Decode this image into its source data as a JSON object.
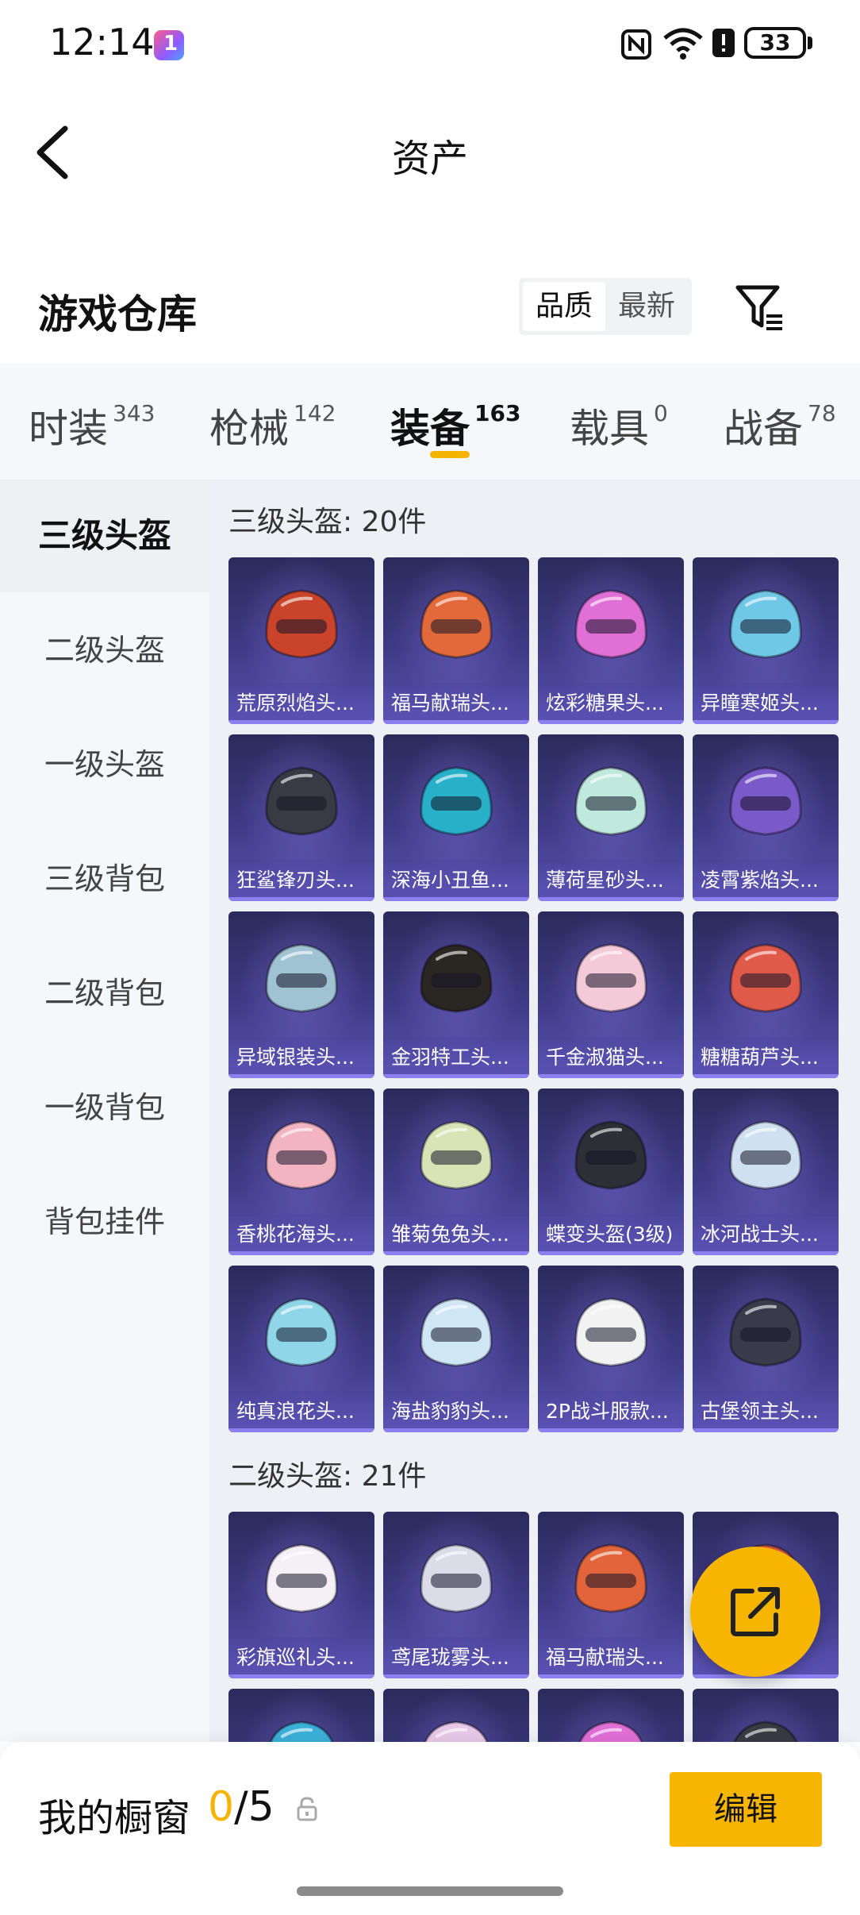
{
  "status_bar": {
    "time": "12:14",
    "battery": "33",
    "icons": [
      "app-badge-icon",
      "nfc-icon",
      "wifi-icon",
      "alert-icon",
      "battery-icon"
    ]
  },
  "header": {
    "title": "资产",
    "back_icon": "chevron-left-icon"
  },
  "warehouse": {
    "title": "游戏仓库",
    "sort_options": [
      "品质",
      "最新"
    ],
    "sort_selected": "品质",
    "filter_icon": "filter-icon"
  },
  "tabs": [
    {
      "label": "时装",
      "count": "343"
    },
    {
      "label": "枪械",
      "count": "142"
    },
    {
      "label": "装备",
      "count": "163",
      "active": true
    },
    {
      "label": "载具",
      "count": "0"
    },
    {
      "label": "战备",
      "count": "78"
    }
  ],
  "sidebar": [
    {
      "label": "三级头盔",
      "active": true
    },
    {
      "label": "二级头盔"
    },
    {
      "label": "一级头盔"
    },
    {
      "label": "三级背包"
    },
    {
      "label": "二级背包"
    },
    {
      "label": "一级背包"
    },
    {
      "label": "背包挂件"
    }
  ],
  "groups": [
    {
      "title": "三级头盔: 20件",
      "items": [
        {
          "name": "荒原烈焰头...",
          "color": "#c9442a"
        },
        {
          "name": "福马献瑞头...",
          "color": "#e26a3a"
        },
        {
          "name": "炫彩糖果头...",
          "color": "#e06fd6"
        },
        {
          "name": "异瞳寒姬头...",
          "color": "#6fc9e6"
        },
        {
          "name": "狂鲨锋刃头...",
          "color": "#3a3a44"
        },
        {
          "name": "深海小丑鱼...",
          "color": "#27b0c8"
        },
        {
          "name": "薄荷星砂头...",
          "color": "#bfe9dc"
        },
        {
          "name": "凌霄紫焰头...",
          "color": "#7a5ac8"
        },
        {
          "name": "异域银装头...",
          "color": "#9fc3d2"
        },
        {
          "name": "金羽特工头...",
          "color": "#2a2622"
        },
        {
          "name": "千金淑猫头...",
          "color": "#f4c9d8"
        },
        {
          "name": "糖糖葫芦头...",
          "color": "#e05a4a"
        },
        {
          "name": "香桃花海头...",
          "color": "#f3b4c2"
        },
        {
          "name": "雏菊兔兔头...",
          "color": "#d9e4b6"
        },
        {
          "name": "蝶变头盔(3级)",
          "color": "#2e2e36"
        },
        {
          "name": "冰河战士头...",
          "color": "#cfe0f0"
        },
        {
          "name": "纯真浪花头...",
          "color": "#8fd6e8"
        },
        {
          "name": "海盐豹豹头...",
          "color": "#cfe6f4"
        },
        {
          "name": "2P战斗服款...",
          "color": "#f2f2f2"
        },
        {
          "name": "古堡领主头...",
          "color": "#3a3a4a"
        }
      ]
    },
    {
      "title": "二级头盔: 21件",
      "items": [
        {
          "name": "彩旗巡礼头...",
          "color": "#f4f0f6"
        },
        {
          "name": "鸢尾珑雾头...",
          "color": "#dcdce8"
        },
        {
          "name": "福马献瑞头...",
          "color": "#e2643a"
        },
        {
          "name": "",
          "color": "#e05a4a"
        },
        {
          "name": "",
          "color": "#3ab0d8"
        },
        {
          "name": "",
          "color": "#e8c8e8"
        },
        {
          "name": "",
          "color": "#e06fd6"
        },
        {
          "name": "",
          "color": "#3a3a44"
        }
      ]
    }
  ],
  "fab": {
    "icon": "share-external-icon"
  },
  "bottom_bar": {
    "label": "我的橱窗",
    "current": "0",
    "separator": "/5",
    "lock_icon": "lock-icon",
    "edit_label": "编辑"
  }
}
